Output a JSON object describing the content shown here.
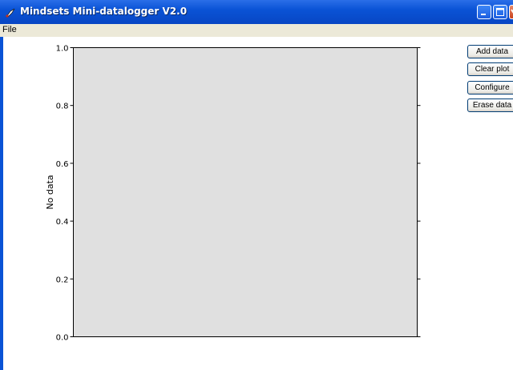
{
  "window": {
    "title": "Mindsets Mini-datalogger V2.0"
  },
  "menu": {
    "file": "File"
  },
  "buttons": {
    "add_data": "Add data",
    "clear_plot": "Clear plot",
    "configure": "Configure",
    "erase_data": "Erase data"
  },
  "chart_data": {
    "type": "line",
    "ylabel": "No data",
    "ylim": [
      0.0,
      1.0
    ],
    "yticks": [
      "0.0",
      "0.2",
      "0.4",
      "0.6",
      "0.8",
      "1.0"
    ],
    "series": [],
    "background": "#e0e0e0",
    "grid": false
  }
}
